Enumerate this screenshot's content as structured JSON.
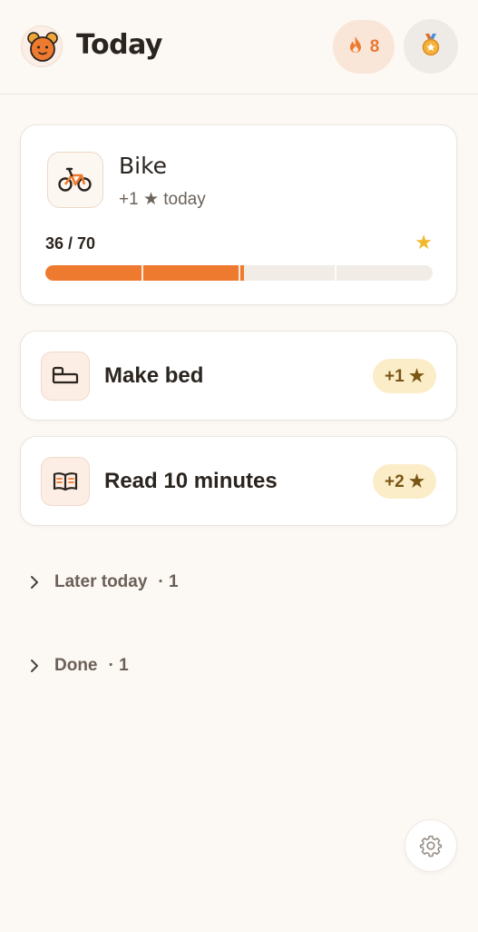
{
  "header": {
    "title": "Today",
    "logo_icon": "bear-mascot-icon",
    "streak": {
      "icon": "flame-icon",
      "count": "8"
    },
    "medal_icon": "medal-icon"
  },
  "goal": {
    "icon": "bicycle-icon",
    "title": "Bike",
    "subtitle": "+1 ★ today",
    "progress_text": "36 / 70",
    "progress_fraction": 0.514,
    "star": "★"
  },
  "tasks": [
    {
      "icon": "bed-icon",
      "label": "Make bed",
      "badge": "+1 ★"
    },
    {
      "icon": "open-book-icon",
      "label": "Read 10 minutes",
      "badge": "+2 ★"
    }
  ],
  "sections": [
    {
      "label": "Later today",
      "count": "· 1"
    },
    {
      "label": "Done",
      "count": "· 1"
    }
  ],
  "settings_icon": "gear-icon",
  "colors": {
    "accent": "#ee7a2f",
    "star": "#f1b82c",
    "background": "#fcf8f3",
    "badge_bg": "#fbedc8"
  }
}
